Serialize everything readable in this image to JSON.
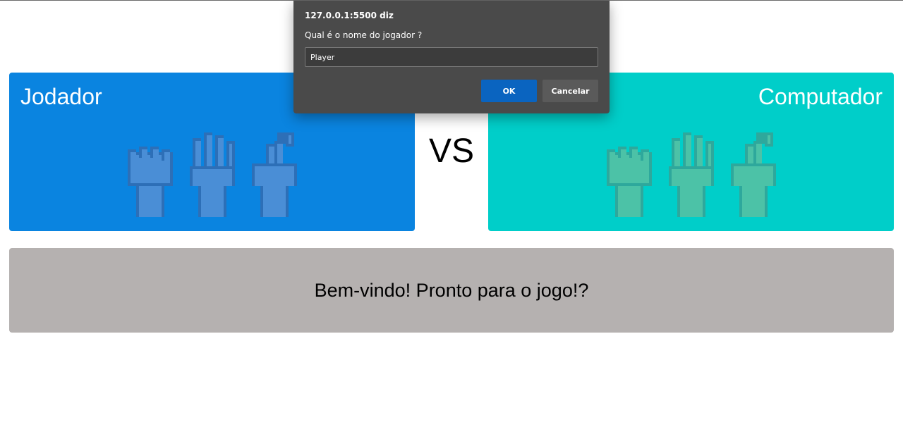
{
  "game": {
    "player_title": "Jodador",
    "computer_title": "Computador",
    "vs_label": "VS",
    "message": "Bem-vindo! Pronto para o jogo!?",
    "choices": [
      "rock-icon",
      "paper-icon",
      "scissors-icon"
    ]
  },
  "dialog": {
    "origin": "127.0.0.1:5500 diz",
    "prompt": "Qual é o nome do jogador ?",
    "input_value": "Player",
    "ok_label": "OK",
    "cancel_label": "Cancelar"
  },
  "colors": {
    "player_card": "#0a84e0",
    "computer_card": "#00cec9",
    "message_box": "#b5b1b0",
    "dialog_bg": "#4a4a4a",
    "ok_button": "#0a64c0"
  }
}
